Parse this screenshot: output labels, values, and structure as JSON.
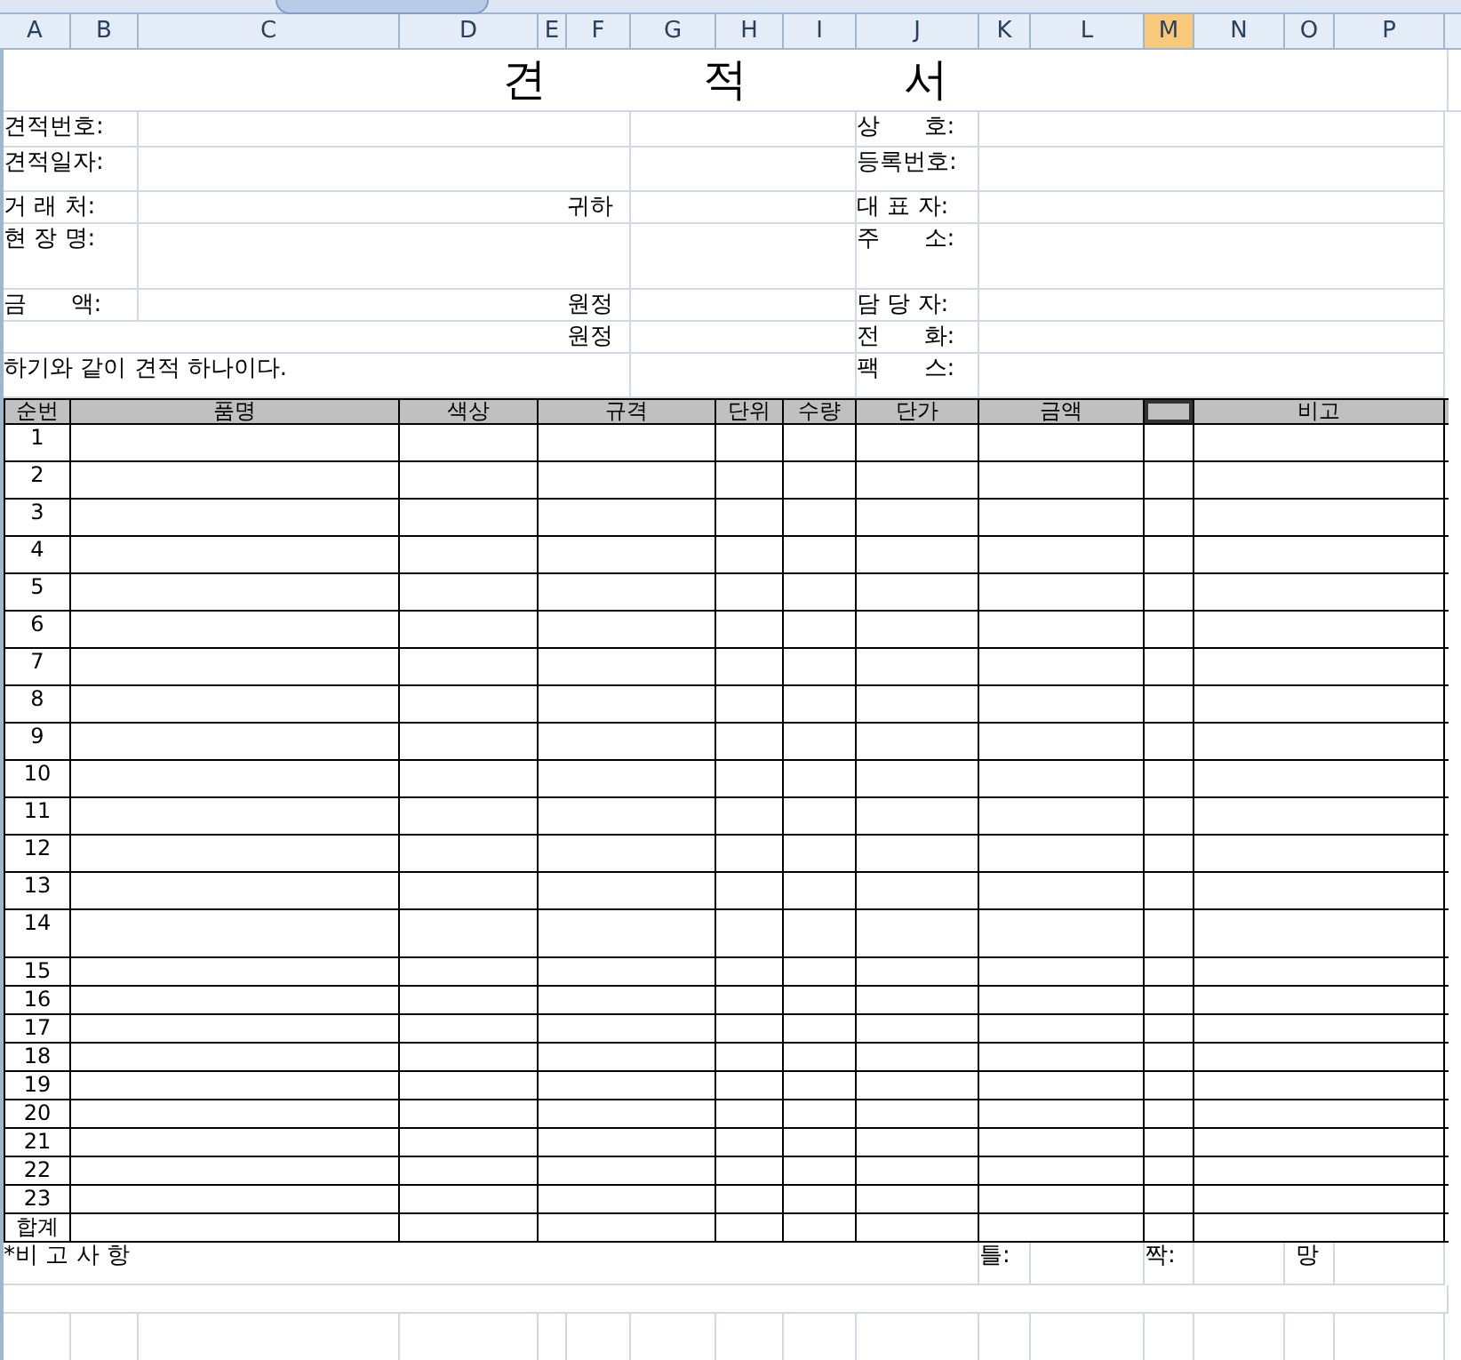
{
  "columns": [
    {
      "label": "A",
      "selected": false
    },
    {
      "label": "B",
      "selected": false
    },
    {
      "label": "C",
      "selected": false
    },
    {
      "label": "D",
      "selected": false
    },
    {
      "label": "E",
      "selected": false
    },
    {
      "label": "F",
      "selected": false
    },
    {
      "label": "G",
      "selected": false
    },
    {
      "label": "H",
      "selected": false
    },
    {
      "label": "I",
      "selected": false
    },
    {
      "label": "J",
      "selected": false
    },
    {
      "label": "K",
      "selected": false
    },
    {
      "label": "L",
      "selected": false
    },
    {
      "label": "M",
      "selected": true
    },
    {
      "label": "N",
      "selected": false
    },
    {
      "label": "O",
      "selected": false
    },
    {
      "label": "P",
      "selected": false
    }
  ],
  "title": "견 적 서",
  "form_rows": [
    {
      "left": "견적번호:",
      "right": "상      호:"
    },
    {
      "left": "견적일자:",
      "right": "등록번호:"
    },
    {
      "left": "거 래 처:",
      "suffix": "귀하",
      "right": "대 표 자:"
    },
    {
      "left": "현 장 명:",
      "right": "주      소:"
    },
    {
      "left": "금      액:",
      "suffix": "원정",
      "right": "담 당 자:"
    },
    {
      "suffix": "원정",
      "right": "전      화:"
    },
    {
      "note": "하기와 같이 견적 하나이다.",
      "right": "팩      스:"
    }
  ],
  "table": {
    "columns": [
      "순번",
      "품명",
      "색상",
      "규격",
      "단위",
      "수량",
      "단가",
      "금액",
      "",
      "비고"
    ],
    "rows": [
      "1",
      "2",
      "3",
      "4",
      "5",
      "6",
      "7",
      "8",
      "9",
      "10",
      "11",
      "12",
      "13",
      "14",
      "15",
      "16",
      "17",
      "18",
      "19",
      "20",
      "21",
      "22",
      "23"
    ],
    "total_label": "합계"
  },
  "footer": {
    "remarks": "*비 고 사 항",
    "frame": "틀:",
    "pair": "짝:",
    "net": "망"
  }
}
